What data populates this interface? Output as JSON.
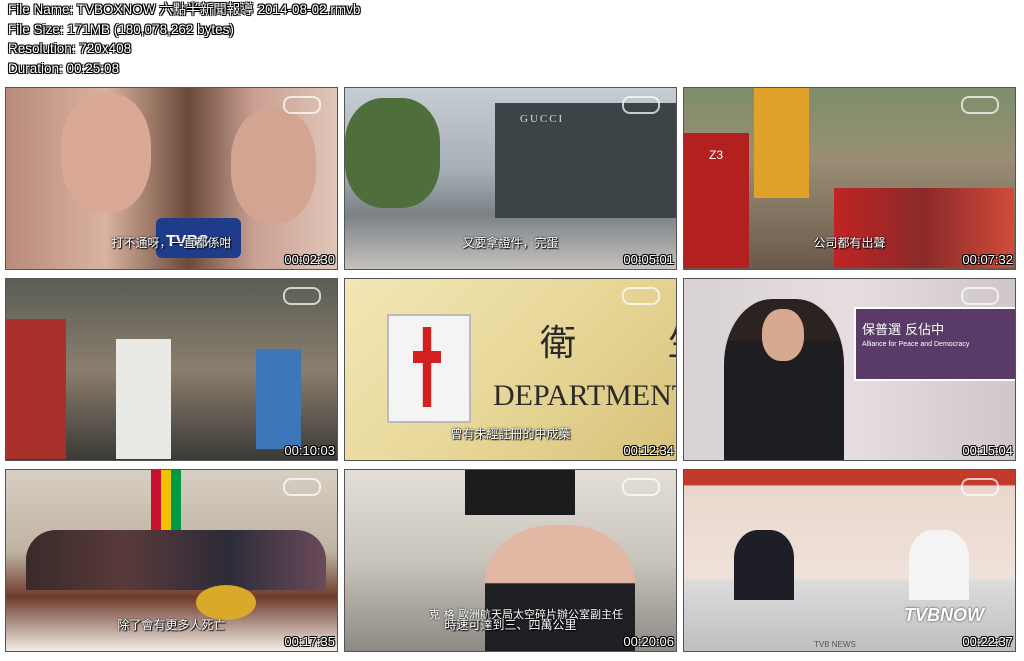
{
  "info": {
    "file_name": "File Name: TVBOXNOW 六點半新聞報導 2014-08-02.rmvb",
    "file_size": "File Size: 171MB (180,078,262 bytes)",
    "resolution": "Resolution: 720x408",
    "duration": "Duration: 00:25:08"
  },
  "thumbnails": [
    {
      "time": "00:02:30",
      "subtitle": "打不通呀，一直都係咁",
      "overlay": "TVBS"
    },
    {
      "time": "00:05:01",
      "subtitle": "又要拿證件，完蛋",
      "overlay": "GUCCI"
    },
    {
      "time": "00:07:32",
      "subtitle": "公司都有出聲",
      "overlay": "Z3"
    },
    {
      "time": "00:10:03",
      "subtitle": "",
      "overlay": ""
    },
    {
      "time": "00:12:34",
      "subtitle": "曾有未經註冊的中成藥",
      "overlay": "衛 生",
      "overlay2": "DEPARTMENT"
    },
    {
      "time": "00:15:04",
      "subtitle": "",
      "overlay": "保普選 反佔中",
      "overlay2": "Alliance for Peace and Democracy"
    },
    {
      "time": "00:17:35",
      "subtitle": "除了會有更多人死亡",
      "overlay": ""
    },
    {
      "time": "00:20:06",
      "subtitle": "時速可達到三、四萬公里",
      "overlay": "克 格  歐洲航天局太空碎片辦公室副主任"
    },
    {
      "time": "00:22:37",
      "subtitle": "",
      "overlay": "TVBNOW",
      "overlay2": "TVB NEWS"
    }
  ]
}
